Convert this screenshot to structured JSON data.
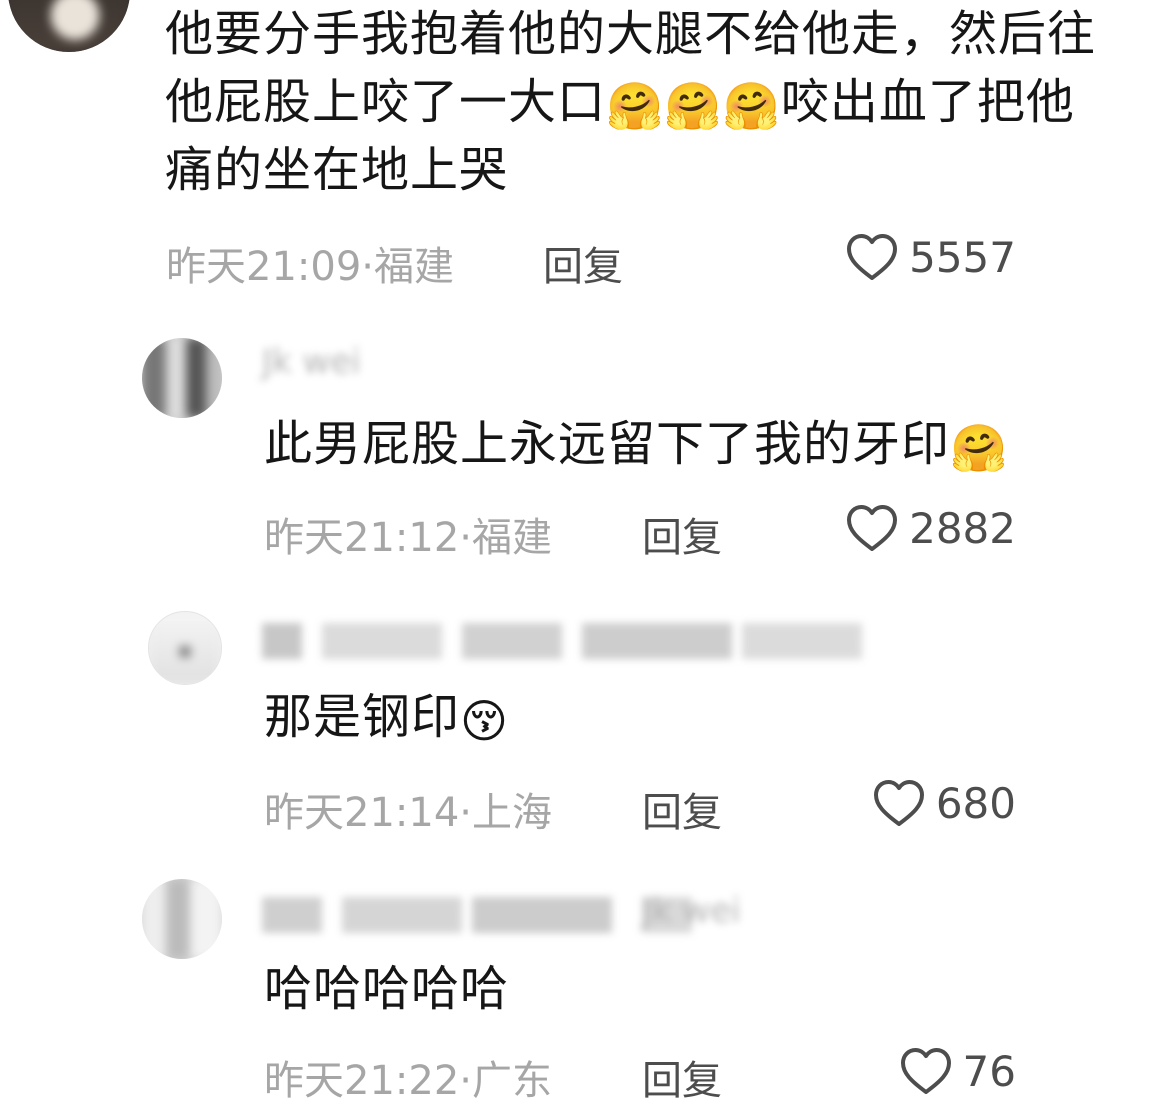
{
  "comments": [
    {
      "text_lines": [
        "他要分手我抱着他的大腿不给他走，然后往",
        "他屁股上咬了一大口",
        "咬出血了把他",
        "痛的坐在地上哭"
      ],
      "emojis": [
        "🤗",
        "🤗",
        "🤗"
      ],
      "time": "昨天21:09",
      "location": "福建",
      "meta": "昨天21:09·福建",
      "reply_label": "回复",
      "likes": "5557"
    },
    {
      "username_partial": "Jk wei",
      "text": "此男屁股上永远留下了我的牙印",
      "emoji": "🤗",
      "meta": "昨天21:12·福建",
      "reply_label": "回复",
      "likes": "2882"
    },
    {
      "text": "那是钢印",
      "emoji": "😚",
      "meta": "昨天21:14·上海",
      "reply_label": "回复",
      "likes": "680"
    },
    {
      "username_partial": "Jk wei",
      "text": "哈哈哈哈哈",
      "meta": "昨天21:22·广东",
      "reply_label": "回复",
      "likes": "76"
    }
  ],
  "icons": {
    "like": "heart-outline-icon"
  },
  "colors": {
    "meta": "#a6a6a6",
    "text": "#161616",
    "reply": "#4d4d4d"
  }
}
